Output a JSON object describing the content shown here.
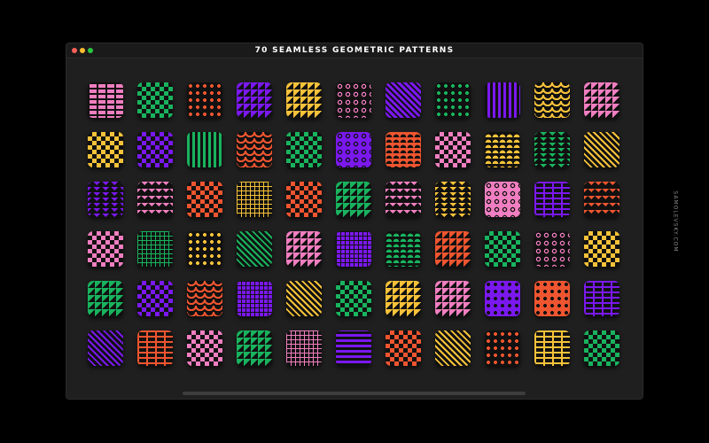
{
  "window": {
    "title": "70 SEAMLESS GEOMETRIC PATTERNS",
    "buttons": [
      {
        "name": "close",
        "color": "#ff5f57"
      },
      {
        "name": "minimize",
        "color": "#febc2e"
      },
      {
        "name": "zoom",
        "color": "#28c840"
      }
    ]
  },
  "watermark": "SAMOLEVSKY.COM",
  "colors": {
    "black": "#111111",
    "pink": "#f07ec0",
    "green": "#19b35e",
    "orange": "#ee5530",
    "purple": "#7a18ee",
    "yellow": "#f7c23a",
    "window_bg": "#1f1f1f"
  },
  "tiles": [
    [
      {
        "a": "black",
        "b": "pink",
        "p": "bricks"
      },
      {
        "a": "black",
        "b": "green",
        "p": "diamonds"
      },
      {
        "a": "black",
        "b": "orange",
        "p": "dots"
      },
      {
        "a": "black",
        "b": "purple",
        "p": "triangles"
      },
      {
        "a": "black",
        "b": "yellow",
        "p": "triangles"
      },
      {
        "a": "black",
        "b": "pink",
        "p": "rings"
      },
      {
        "a": "purple",
        "b": "black",
        "p": "diagonal"
      },
      {
        "a": "black",
        "b": "green",
        "p": "dots"
      },
      {
        "a": "purple",
        "b": "black",
        "p": "vstripes"
      },
      {
        "a": "black",
        "b": "yellow",
        "p": "waves"
      },
      {
        "a": "black",
        "b": "pink",
        "p": "triangles"
      }
    ],
    [
      {
        "a": "black",
        "b": "yellow",
        "p": "checker"
      },
      {
        "a": "purple",
        "b": "black",
        "p": "diamonds"
      },
      {
        "a": "black",
        "b": "green",
        "p": "vstripes"
      },
      {
        "a": "black",
        "b": "orange",
        "p": "waves"
      },
      {
        "a": "black",
        "b": "green",
        "p": "diamonds"
      },
      {
        "a": "purple",
        "b": "black",
        "p": "rings"
      },
      {
        "a": "orange",
        "b": "black",
        "p": "scales"
      },
      {
        "a": "black",
        "b": "pink",
        "p": "checker"
      },
      {
        "a": "black",
        "b": "yellow",
        "p": "scales"
      },
      {
        "a": "black",
        "b": "green",
        "p": "chevrons"
      },
      {
        "a": "black",
        "b": "yellow",
        "p": "diagonal"
      }
    ],
    [
      {
        "a": "black",
        "b": "purple",
        "p": "chevrons"
      },
      {
        "a": "black",
        "b": "pink",
        "p": "zigzag"
      },
      {
        "a": "black",
        "b": "orange",
        "p": "checker"
      },
      {
        "a": "black",
        "b": "yellow",
        "p": "grid"
      },
      {
        "a": "black",
        "b": "orange",
        "p": "checker"
      },
      {
        "a": "black",
        "b": "green",
        "p": "triangles"
      },
      {
        "a": "black",
        "b": "pink",
        "p": "zigzag"
      },
      {
        "a": "black",
        "b": "yellow",
        "p": "chevrons"
      },
      {
        "a": "pink",
        "b": "black",
        "p": "rings"
      },
      {
        "a": "purple",
        "b": "black",
        "p": "bricks"
      },
      {
        "a": "black",
        "b": "orange",
        "p": "zigzag"
      }
    ],
    [
      {
        "a": "black",
        "b": "pink",
        "p": "diamonds"
      },
      {
        "a": "black",
        "b": "green",
        "p": "grid"
      },
      {
        "a": "black",
        "b": "yellow",
        "p": "dots"
      },
      {
        "a": "black",
        "b": "green",
        "p": "diagonal"
      },
      {
        "a": "black",
        "b": "pink",
        "p": "triangles"
      },
      {
        "a": "purple",
        "b": "black",
        "p": "grid"
      },
      {
        "a": "black",
        "b": "green",
        "p": "scales"
      },
      {
        "a": "black",
        "b": "orange",
        "p": "triangles"
      },
      {
        "a": "green",
        "b": "black",
        "p": "diamonds"
      },
      {
        "a": "black",
        "b": "pink",
        "p": "rings"
      },
      {
        "a": "black",
        "b": "yellow",
        "p": "checker"
      }
    ],
    [
      {
        "a": "black",
        "b": "green",
        "p": "triangles"
      },
      {
        "a": "purple",
        "b": "black",
        "p": "diamonds"
      },
      {
        "a": "black",
        "b": "orange",
        "p": "waves"
      },
      {
        "a": "purple",
        "b": "black",
        "p": "grid"
      },
      {
        "a": "black",
        "b": "yellow",
        "p": "diagonal"
      },
      {
        "a": "black",
        "b": "green",
        "p": "checker"
      },
      {
        "a": "black",
        "b": "yellow",
        "p": "triangles"
      },
      {
        "a": "black",
        "b": "pink",
        "p": "triangles"
      },
      {
        "a": "purple",
        "b": "black",
        "p": "dots"
      },
      {
        "a": "orange",
        "b": "black",
        "p": "dots"
      },
      {
        "a": "purple",
        "b": "black",
        "p": "bricks"
      }
    ],
    [
      {
        "a": "black",
        "b": "purple",
        "p": "diagonal"
      },
      {
        "a": "orange",
        "b": "black",
        "p": "bricks"
      },
      {
        "a": "black",
        "b": "pink",
        "p": "checker"
      },
      {
        "a": "black",
        "b": "green",
        "p": "triangles"
      },
      {
        "a": "black",
        "b": "pink",
        "p": "grid"
      },
      {
        "a": "purple",
        "b": "black",
        "p": "hstripes"
      },
      {
        "a": "black",
        "b": "orange",
        "p": "checker"
      },
      {
        "a": "black",
        "b": "yellow",
        "p": "diagonal"
      },
      {
        "a": "black",
        "b": "orange",
        "p": "dots"
      },
      {
        "a": "yellow",
        "b": "black",
        "p": "bricks"
      },
      {
        "a": "black",
        "b": "green",
        "p": "diamonds"
      }
    ]
  ]
}
